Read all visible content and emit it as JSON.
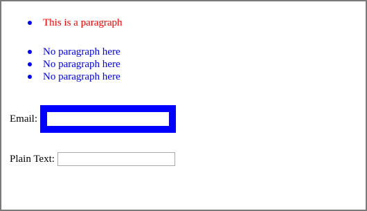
{
  "list_one": {
    "items": [
      {
        "text": "This is a paragraph",
        "color": "#ff0000"
      }
    ]
  },
  "list_two": {
    "items": [
      {
        "text": "No paragraph here",
        "color": "#0000ff"
      },
      {
        "text": "No paragraph here",
        "color": "#0000ff"
      },
      {
        "text": "No paragraph here",
        "color": "#0000ff"
      }
    ]
  },
  "form": {
    "email_label": "Email:",
    "email_value": "",
    "plain_label": "Plain Text:",
    "plain_value": ""
  },
  "colors": {
    "accent_blue": "#0000ff",
    "paragraph_red": "#ff0000",
    "frame_border": "#7a7a7a"
  },
  "icons": {
    "bullet": "filled-circle-bullet-icon"
  }
}
